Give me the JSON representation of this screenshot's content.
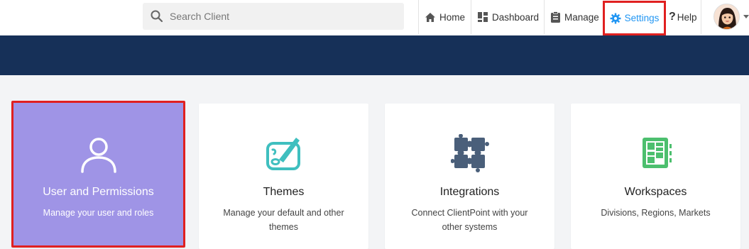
{
  "search": {
    "placeholder": "Search Client"
  },
  "nav": {
    "home": "Home",
    "dashboard": "Dashboard",
    "manage": "Manage",
    "settings": "Settings",
    "help": "Help"
  },
  "colors": {
    "banner": "#163058",
    "accent": "#2196f3",
    "highlight_border": "#e02020",
    "users_card": "#9f94e6",
    "themes_icon": "#3fbfbf",
    "integrations_icon": "#4a5f7a",
    "workspaces_icon": "#4cbf6e"
  },
  "cards": [
    {
      "title": "User and Permissions",
      "description": "Manage your user and roles",
      "icon": "user-icon"
    },
    {
      "title": "Themes",
      "description": "Manage your default and other themes",
      "icon": "palette-icon"
    },
    {
      "title": "Integrations",
      "description": "Connect ClientPoint with your other systems",
      "icon": "puzzle-icon"
    },
    {
      "title": "Workspaces",
      "description": "Divisions, Regions, Markets",
      "icon": "workspace-icon"
    }
  ]
}
